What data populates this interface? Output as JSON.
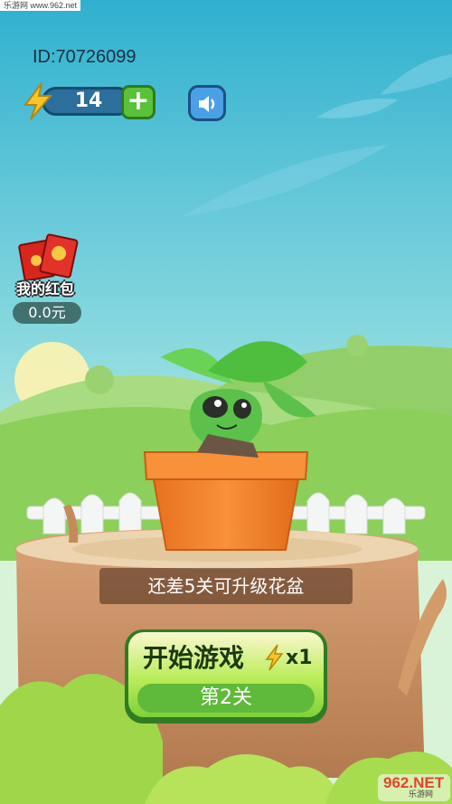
{
  "watermark_top": "乐游网 www.962.net",
  "header": {
    "user_id": "ID:70726099",
    "energy": "14",
    "add_energy_icon": "plus-icon",
    "sound_icon": "speaker-icon"
  },
  "red_packet": {
    "label": "我的红包",
    "amount": "0.0元",
    "icon": "red-envelope-icon"
  },
  "level_hint": "还差5关可升级花盆",
  "start_button": {
    "label": "开始游戏",
    "cost": "x1",
    "stage": "第2关"
  },
  "watermark_bottom": {
    "logo": "962.NET",
    "sub": "乐游网"
  },
  "colors": {
    "sky": "#3fb3d4",
    "grass": "#8ccf5a",
    "pot": "#f07e2a",
    "button_green": "#7fd13a"
  }
}
